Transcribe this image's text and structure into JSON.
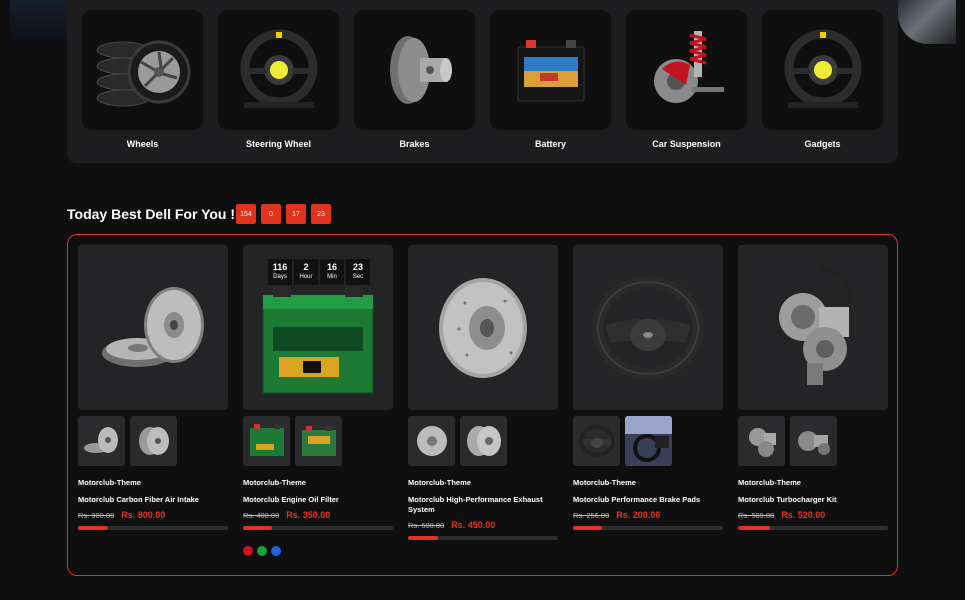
{
  "categories": [
    {
      "label": "Wheels",
      "icon": "wheel-icon"
    },
    {
      "label": "Steering Wheel",
      "icon": "steering-wheel-icon"
    },
    {
      "label": "Brakes",
      "icon": "brake-icon"
    },
    {
      "label": "Battery",
      "icon": "battery-icon"
    },
    {
      "label": "Car Suspension",
      "icon": "suspension-icon"
    },
    {
      "label": "Gadgets",
      "icon": "steering-wheel-icon"
    }
  ],
  "deal": {
    "title": "Today Best Dell For You !",
    "timer": [
      "154",
      "0",
      "17",
      "23"
    ]
  },
  "products": [
    {
      "brand": "Motorclub-Theme",
      "name": "Motorclub Carbon Fiber Air Intake",
      "old_price": "Rs. 900.00",
      "new_price": "Rs. 800.00",
      "sold_fraction": 0.2,
      "image": "brake-disc-icon"
    },
    {
      "brand": "Motorclub-Theme",
      "name": "Motorclub Engine Oil Filter",
      "old_price": "Rs. 400.00",
      "new_price": "Rs. 350.00",
      "sold_fraction": 0.19,
      "image": "battery-icon",
      "countdown": [
        {
          "num": "116",
          "lbl": "Days"
        },
        {
          "num": "2",
          "lbl": "Hour"
        },
        {
          "num": "16",
          "lbl": "Min"
        },
        {
          "num": "23",
          "lbl": "Sec"
        }
      ],
      "swatches": [
        "#d0102a",
        "#12a33a",
        "#1f63e0"
      ]
    },
    {
      "brand": "Motorclub-Theme",
      "name": "Motorclub High-Performance Exhaust System",
      "old_price": "Rs. 500.00",
      "new_price": "Rs. 450.00",
      "sold_fraction": 0.2,
      "image": "brake-disc-icon"
    },
    {
      "brand": "Motorclub-Theme",
      "name": "Motorclub Performance Brake Pads",
      "old_price": "Rs. 256.00",
      "new_price": "Rs. 200.00",
      "sold_fraction": 0.19,
      "image": "steering-wheel-icon"
    },
    {
      "brand": "Motorclub-Theme",
      "name": "Motorclub Turbocharger Kit",
      "old_price": "Rs. 589.00",
      "new_price": "Rs. 520.00",
      "sold_fraction": 0.21,
      "image": "turbo-icon"
    }
  ],
  "colors": {
    "accent": "#e5321f",
    "panel": "#1d1d1f"
  }
}
